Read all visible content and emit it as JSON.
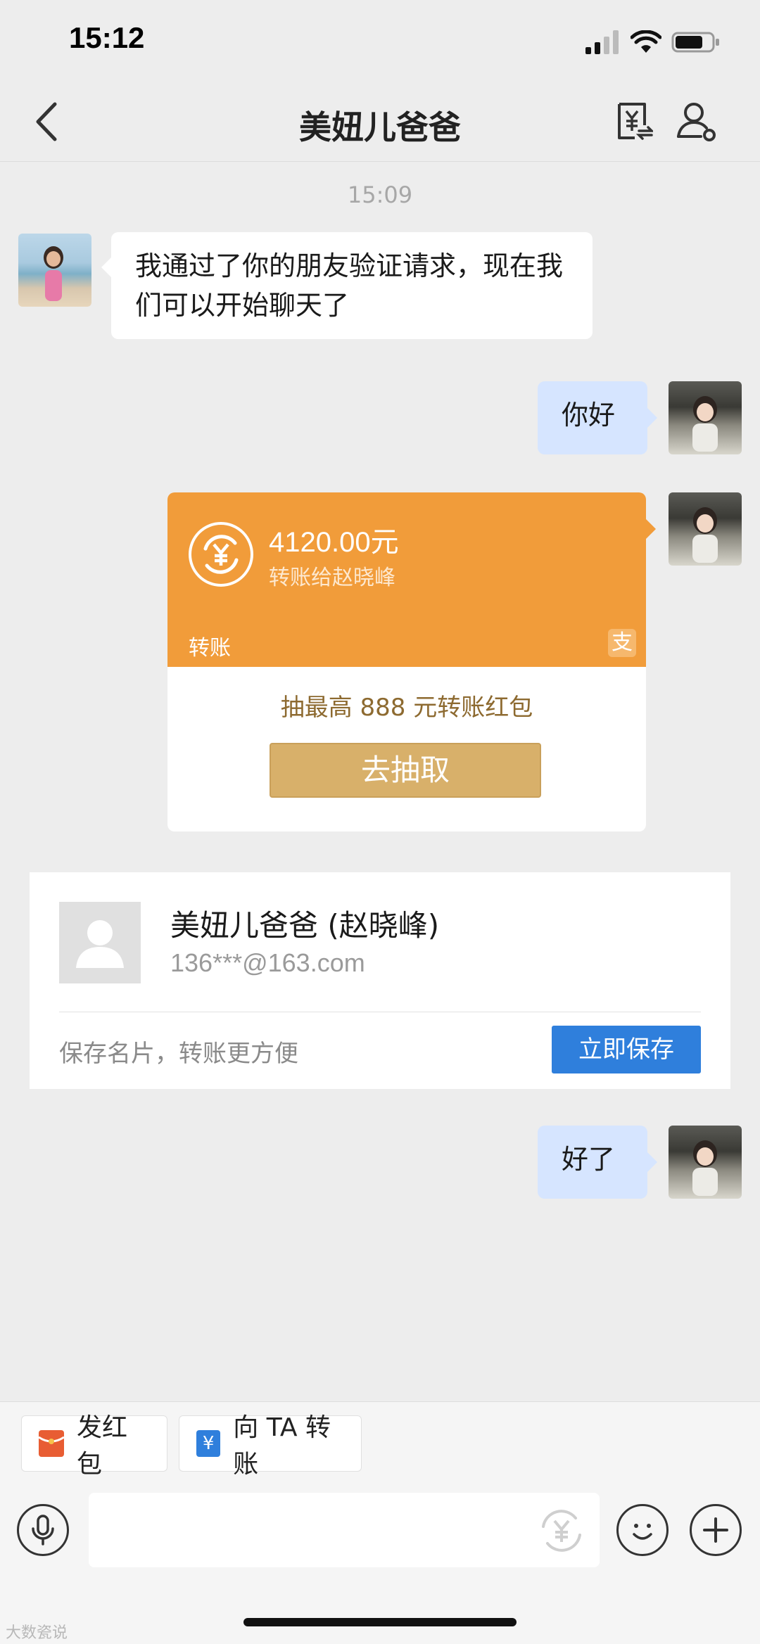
{
  "status": {
    "time": "15:12"
  },
  "nav": {
    "title": "美妞儿爸爸"
  },
  "chat": {
    "time_separator": "15:09",
    "incoming_message": "我通过了你的朋友验证请求，现在我们可以开始聊天了",
    "outgoing_1": "你好",
    "outgoing_2": "好了"
  },
  "transfer": {
    "amount": "4120.00元",
    "recipient": "转账给赵晓峰",
    "type_label": "转账",
    "alipay_glyph": "支",
    "promo": "抽最高 888 元转账红包",
    "action": "去抽取"
  },
  "contact": {
    "name": "美妞儿爸爸 (赵晓峰)",
    "email": "136***@163.com",
    "hint": "保存名片，转账更方便",
    "save_label": "立即保存"
  },
  "bottom": {
    "red_packet": "发红包",
    "transfer_label": "向 TA 转账",
    "transfer_glyph": "¥",
    "watermark": "大数瓷说"
  },
  "colors": {
    "transfer_orange": "#f19c3a",
    "button_gold": "#d8b06a",
    "save_blue": "#2f7fdc",
    "outgoing_bubble": "#d6e5ff"
  }
}
